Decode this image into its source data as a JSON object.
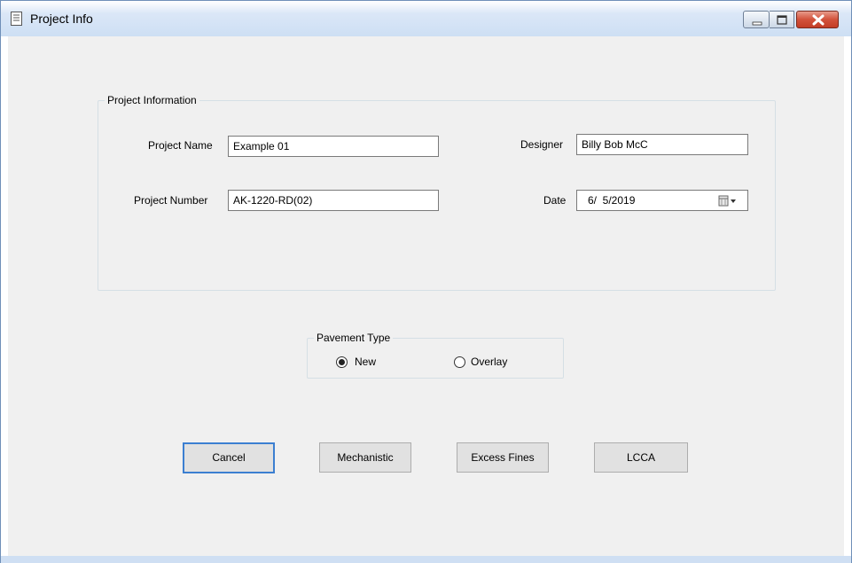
{
  "window": {
    "title": "Project Info"
  },
  "project_info": {
    "group_label": "Project Information",
    "project_name_label": "Project Name",
    "project_name_value": "Example 01",
    "project_number_label": "Project Number",
    "project_number_value": "AK-1220-RD(02)",
    "designer_label": "Designer",
    "designer_value": "Billy Bob McC",
    "date_label": "Date",
    "date_value": "6/  5/2019"
  },
  "pavement_type": {
    "group_label": "Pavement Type",
    "options": [
      {
        "label": "New",
        "selected": true
      },
      {
        "label": "Overlay",
        "selected": false
      }
    ]
  },
  "buttons": {
    "cancel": "Cancel",
    "mechanistic": "Mechanistic",
    "excess_fines": "Excess Fines",
    "lcca": "LCCA"
  },
  "icons": {
    "title": "document-icon",
    "minimize": "minimize-icon",
    "maximize": "maximize-icon",
    "close": "close-icon",
    "date_picker": "calendar-dropdown-icon"
  },
  "colors": {
    "default_button_border": "#3c7fd1",
    "close_button": "#c94a33"
  }
}
